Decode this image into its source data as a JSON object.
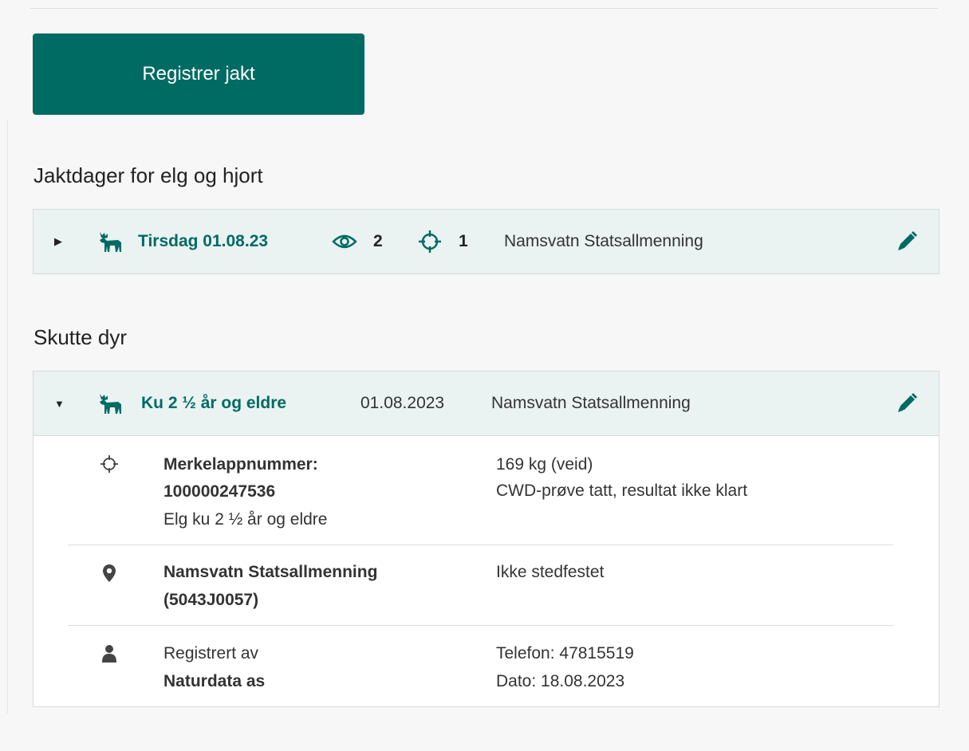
{
  "register_button": {
    "label": "Registrer jakt"
  },
  "hunting_days": {
    "heading": "Jaktdager for elg og hjort",
    "entries": [
      {
        "title": "Tirsdag 01.08.23",
        "observed_count": "2",
        "shot_count": "1",
        "area": "Namsvatn Statsallmenning",
        "icons": {
          "species": "moose-icon",
          "observed": "eye-icon",
          "shot": "crosshair-icon",
          "edit": "pencil-icon"
        }
      }
    ]
  },
  "shot_animals": {
    "heading": "Skutte dyr",
    "entries": [
      {
        "title": "Ku 2 ½ år og eldre",
        "date": "01.08.2023",
        "area": "Namsvatn Statsallmenning",
        "details": {
          "tag": {
            "label_line1": "Merkelappnummer:",
            "label_line2": "100000247536",
            "description": "Elg ku 2 ½ år og eldre",
            "weight": "169 kg (veid)",
            "cwd_status": "CWD-prøve tatt, resultat ikke klart"
          },
          "location": {
            "name_line1": "Namsvatn Statsallmenning",
            "name_line2": "(5043J0057)",
            "position": "Ikke stedfestet"
          },
          "registered": {
            "label": "Registrert av",
            "by": "Naturdata as",
            "phone": "Telefon: 47815519",
            "date": "Dato: 18.08.2023"
          }
        }
      }
    ]
  },
  "colors": {
    "accent": "#006b63",
    "header_bg": "#eaf3f2",
    "page_bg": "#f7f7f7"
  }
}
